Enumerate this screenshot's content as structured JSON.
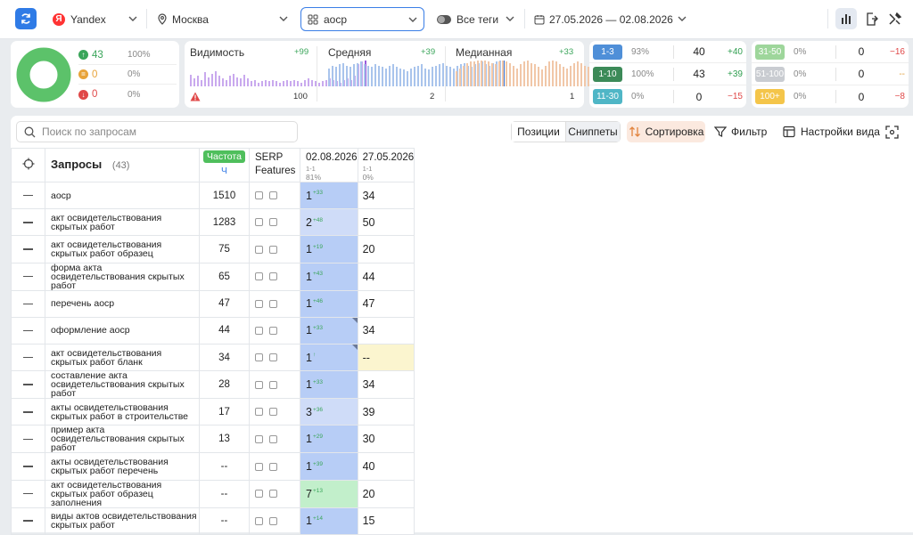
{
  "topbar": {
    "engine": "Yandex",
    "engine_letter": "Я",
    "region": "Москва",
    "project": "аоср",
    "tags": "Все теги",
    "date_range": "27.05.2026 — 02.08.2026"
  },
  "summary": {
    "up": {
      "count": "43",
      "pct": "100%"
    },
    "same": {
      "count": "0",
      "pct": "0%"
    },
    "down": {
      "count": "0",
      "pct": "0%"
    }
  },
  "sparks": [
    {
      "title": "Видимость",
      "delta": "+99",
      "footer": "100",
      "color": "#c9a9ee",
      "last": "#9a5cdb",
      "values": [
        45,
        30,
        40,
        25,
        55,
        35,
        50,
        60,
        40,
        30,
        25,
        40,
        50,
        35,
        30,
        45,
        30,
        20,
        25,
        15,
        20,
        25,
        20,
        25,
        20,
        15,
        20,
        25,
        20,
        25,
        20,
        15,
        25,
        30,
        25,
        20,
        15,
        20,
        25,
        30,
        25,
        20,
        15,
        25,
        30,
        25,
        40,
        85,
        95,
        100
      ]
    },
    {
      "title": "Средняя",
      "delta": "+39",
      "footer": "2",
      "color": "#a9c4ec",
      "last": "#3a73d6",
      "values": [
        70,
        80,
        75,
        85,
        90,
        80,
        75,
        85,
        90,
        95,
        85,
        80,
        75,
        85,
        80,
        75,
        70,
        80,
        85,
        75,
        70,
        65,
        60,
        70,
        75,
        80,
        85,
        70,
        65,
        75,
        80,
        85,
        90,
        80,
        75,
        70,
        80,
        85,
        90,
        80,
        75,
        85,
        90,
        95,
        85,
        80,
        90,
        95,
        100,
        100
      ]
    },
    {
      "title": "Медианная",
      "delta": "+33",
      "footer": "1",
      "color": "#f1c7a8",
      "last": "#e2843f",
      "values": [
        60,
        70,
        80,
        90,
        95,
        95,
        100,
        100,
        100,
        95,
        90,
        85,
        95,
        100,
        95,
        90,
        80,
        70,
        85,
        95,
        100,
        90,
        85,
        75,
        65,
        80,
        95,
        100,
        95,
        85,
        75,
        70,
        80,
        90,
        95,
        90,
        80,
        75,
        70,
        80,
        85,
        90,
        95,
        90,
        85,
        80,
        90,
        95,
        100,
        100
      ]
    }
  ],
  "dist_left": [
    {
      "label": "1-3",
      "pct": "93%",
      "val": "40",
      "delta": "+40",
      "color": "#4f8fd8",
      "dcolor": "#2f9e4f"
    },
    {
      "label": "1-10",
      "pct": "100%",
      "val": "43",
      "delta": "+39",
      "color": "#3c8a58",
      "dcolor": "#2f9e4f"
    },
    {
      "label": "11-30",
      "pct": "0%",
      "val": "0",
      "delta": "−15",
      "color": "#4fb6c6",
      "dcolor": "#e04848"
    }
  ],
  "dist_right": [
    {
      "label": "31-50",
      "pct": "0%",
      "val": "0",
      "delta": "−16",
      "color": "#9ed69b",
      "dcolor": "#e04848"
    },
    {
      "label": "51-100",
      "pct": "0%",
      "val": "0",
      "delta": "--",
      "color": "#c9ccd1",
      "dcolor": "#e0a040"
    },
    {
      "label": "100+",
      "pct": "0%",
      "val": "0",
      "delta": "−8",
      "color": "#f4c54a",
      "dcolor": "#e04848"
    }
  ],
  "toolbar": {
    "search_placeholder": "Поиск по запросам",
    "positions": "Позиции",
    "snippets": "Сниппеты",
    "sort": "Сортировка",
    "filter": "Фильтр",
    "view_settings": "Настройки вида"
  },
  "table": {
    "queries_header": "Запросы",
    "queries_count": "(43)",
    "freq_badge": "Частота",
    "freq_sub": "Ч",
    "serp_header": "SERP Features",
    "col_dates": [
      {
        "date": "02.08.2026",
        "range": "1-1",
        "pct": "81%"
      },
      {
        "date": "27.05.2026",
        "range": "1-1",
        "pct": "0%"
      }
    ],
    "rows": [
      {
        "q": "аоср",
        "f": "1510",
        "p1": "1",
        "d1": "+33",
        "p2": "34",
        "bg1": "#b7cdf6",
        "bg2": "#fff",
        "tri": false
      },
      {
        "q": "акт освидетельствования скрытых работ",
        "f": "1283",
        "p1": "2",
        "d1": "+48",
        "p2": "50",
        "bg1": "#cfdcf8",
        "bg2": "#fff",
        "tri": false
      },
      {
        "q": "акт освидетельствования скрытых работ образец",
        "f": "75",
        "p1": "1",
        "d1": "+19",
        "p2": "20",
        "bg1": "#b7cdf6",
        "bg2": "#fff",
        "tri": false
      },
      {
        "q": "форма акта освидетельствования скрытых работ",
        "f": "65",
        "p1": "1",
        "d1": "+43",
        "p2": "44",
        "bg1": "#b7cdf6",
        "bg2": "#fff",
        "tri": false
      },
      {
        "q": "перечень аоср",
        "f": "47",
        "p1": "1",
        "d1": "+46",
        "p2": "47",
        "bg1": "#b7cdf6",
        "bg2": "#fff",
        "tri": false
      },
      {
        "q": "оформление аоср",
        "f": "44",
        "p1": "1",
        "d1": "+33",
        "p2": "34",
        "bg1": "#b7cdf6",
        "bg2": "#fff",
        "tri": true
      },
      {
        "q": "акт освидетельствования скрытых работ бланк",
        "f": "34",
        "p1": "1",
        "d1": "↑",
        "p2": "--",
        "bg1": "#b7cdf6",
        "bg2": "#fbf5cf",
        "tri": true
      },
      {
        "q": "составление акта освидетельствования скрытых работ",
        "f": "28",
        "p1": "1",
        "d1": "+33",
        "p2": "34",
        "bg1": "#b7cdf6",
        "bg2": "#fff",
        "tri": false
      },
      {
        "q": "акты освидетельствования скрытых работ в строительстве",
        "f": "17",
        "p1": "3",
        "d1": "+36",
        "p2": "39",
        "bg1": "#cfdcf8",
        "bg2": "#fff",
        "tri": false
      },
      {
        "q": "пример акта освидетельствования скрытых работ",
        "f": "13",
        "p1": "1",
        "d1": "+29",
        "p2": "30",
        "bg1": "#b7cdf6",
        "bg2": "#fff",
        "tri": false
      },
      {
        "q": "акты освидетельствования скрытых работ перечень",
        "f": "--",
        "p1": "1",
        "d1": "+39",
        "p2": "40",
        "bg1": "#b7cdf6",
        "bg2": "#fff",
        "tri": false
      },
      {
        "q": "акт освидетельствования скрытых работ образец заполнения",
        "f": "--",
        "p1": "7",
        "d1": "+13",
        "p2": "20",
        "bg1": "#c2efcb",
        "bg2": "#fff",
        "tri": false
      },
      {
        "q": "виды актов освидетельствования скрытых работ",
        "f": "--",
        "p1": "1",
        "d1": "+14",
        "p2": "15",
        "bg1": "#b7cdf6",
        "bg2": "#fff",
        "tri": false
      }
    ]
  }
}
